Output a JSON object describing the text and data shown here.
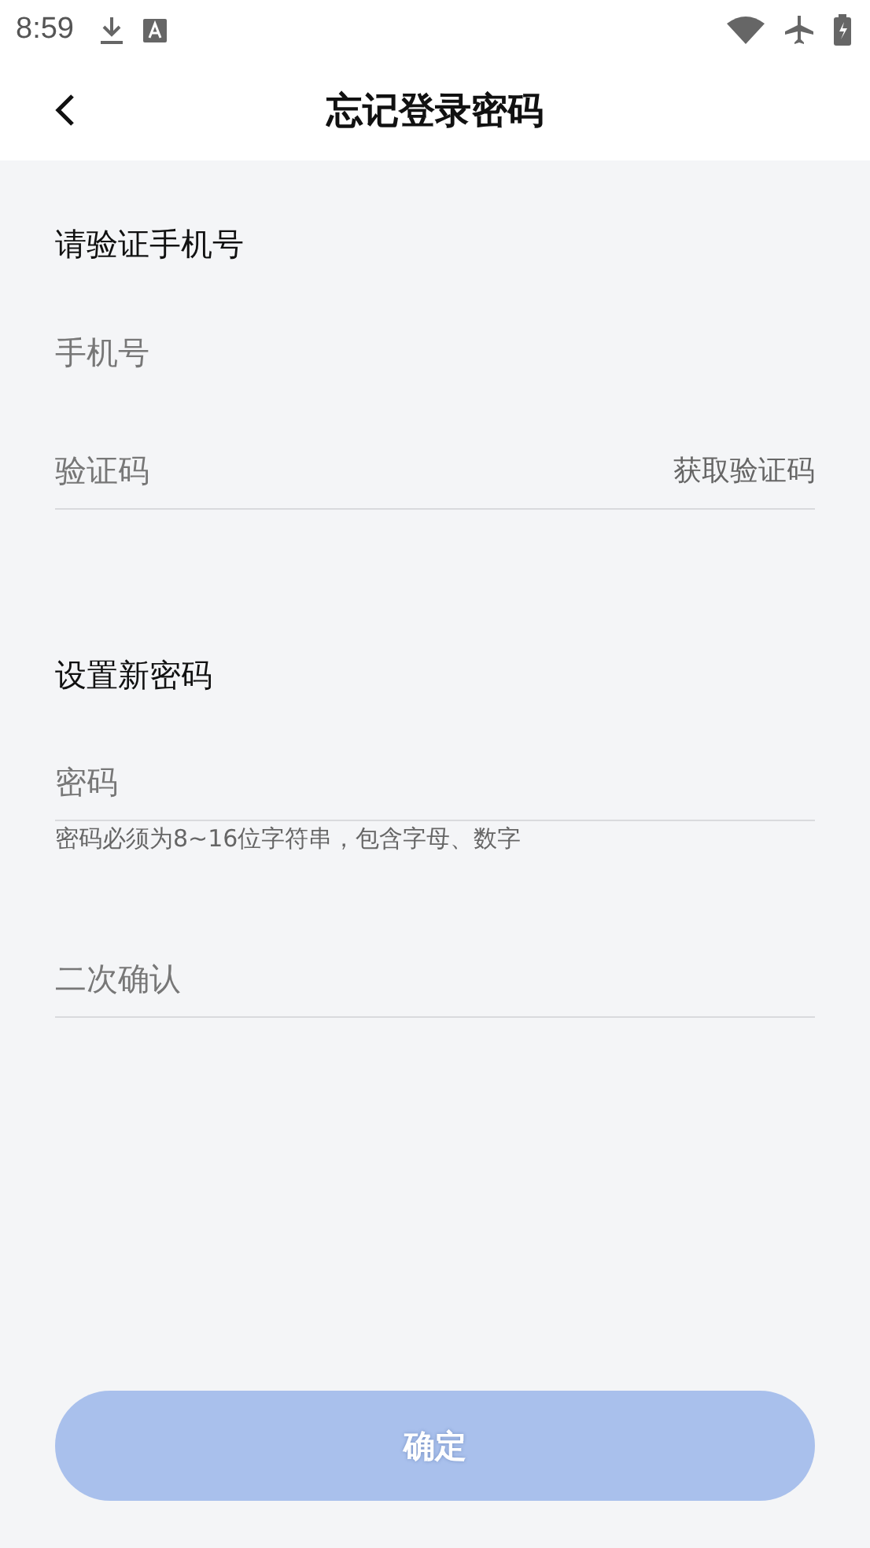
{
  "status_bar": {
    "time": "8:59"
  },
  "header": {
    "title": "忘记登录密码"
  },
  "sections": [
    {
      "title": "请验证手机号",
      "fields": [
        {
          "placeholder": "手机号",
          "underline": false
        },
        {
          "placeholder": "验证码",
          "underline": true,
          "action": "获取验证码"
        }
      ]
    },
    {
      "title": "设置新密码",
      "fields": [
        {
          "placeholder": "密码",
          "underline": true,
          "hint": "密码必须为8~16位字符串，包含字母、数字"
        },
        {
          "placeholder": "二次确认",
          "underline": true
        }
      ]
    }
  ],
  "submit": {
    "label": "确定",
    "disabled": true
  }
}
